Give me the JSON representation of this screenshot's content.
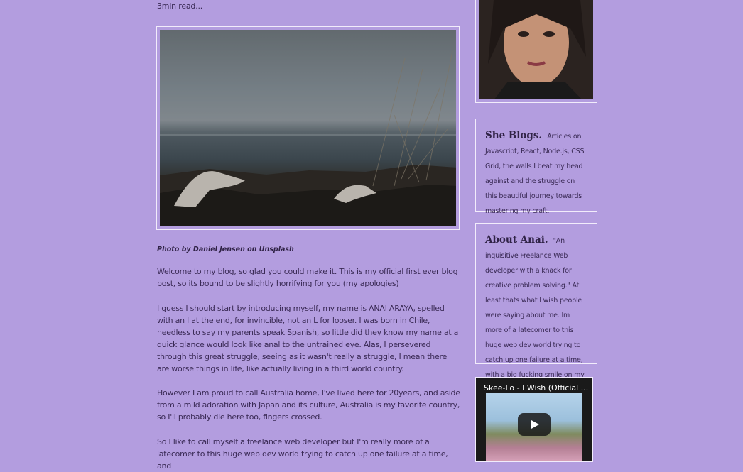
{
  "post": {
    "read_time": "3min read...",
    "caption": "Photo by Daniel Jensen on Unsplash",
    "paragraphs": [
      "Welcome to my blog, so glad you could make it. This is my official first ever blog post, so its bound to be slightly horrifying for you (my apologies)",
      "I guess I should start by introducing myself, my name is ANAI ARAYA, spelled with an I at the end, for invincible, not an L for looser. I was born in Chile, needless to say my parents speak Spanish, so little did they know my name at a quick glance would look like anal to the untrained eye. Alas, I persevered through this great struggle, seeing as it wasn't really a struggle, I mean there are worse things in life, like actually living in a third world country.",
      "However I am proud to call Australia home, I've lived here for 20years, and aside from a mild adoration with Japan and its culture, Australia is my favorite country, so I'll probably die here too, fingers crossed.",
      "So I like to call myself a freelance web developer but I'm really more of a latecomer to this huge web dev world trying to catch up one failure at a time, and"
    ]
  },
  "sidebar": {
    "blogs": {
      "heading": "She Blogs.",
      "text": "Articles on Javascript, React, Node.js, CSS Grid, the walls I beat my head against and the struggle on this beautiful journey towards mastering my craft."
    },
    "about": {
      "heading": "About Anai.",
      "text": "\"An inquisitive Freelance Web developer with a knack for creative problem solving.\" At least thats what I wish people were saying about me. Im more of a latecomer to this huge web dev world trying to catch up one failure at a time, with a big fucking smile on my face!"
    },
    "video": {
      "title": "Skee-Lo - I Wish (Official ...",
      "play_icon": "play-icon"
    }
  },
  "colors": {
    "background": "#b39ddf",
    "text": "#3a2a55",
    "border": "#f2ecfb"
  }
}
